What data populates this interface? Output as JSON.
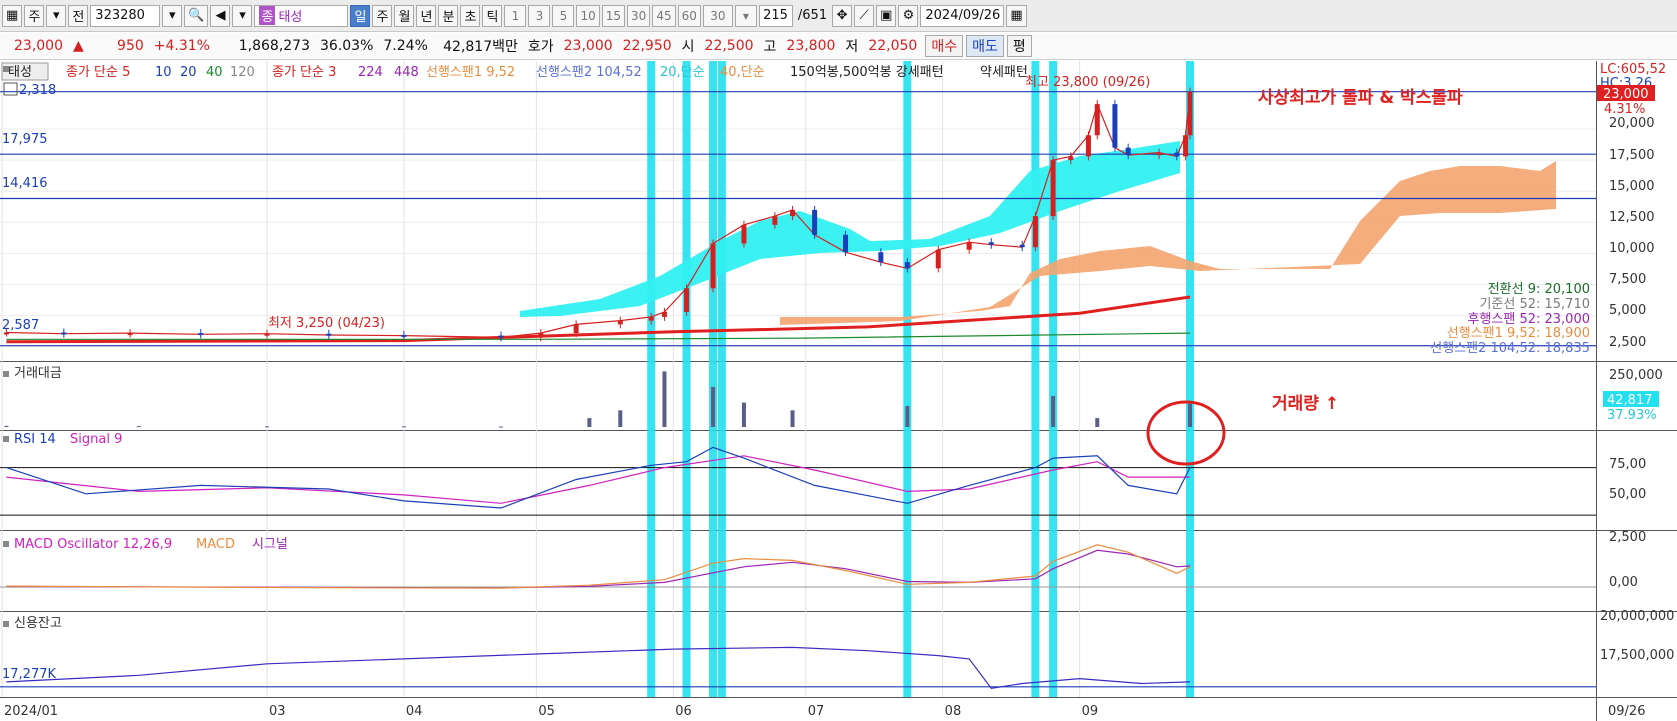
{
  "toolbar": {
    "period_buttons": [
      "주",
      "전"
    ],
    "code": "323280",
    "stock_prefix": "종",
    "stock_name": "태성",
    "timeframes": [
      "일",
      "주",
      "월",
      "년",
      "분",
      "초",
      "틱"
    ],
    "active_timeframe": "일",
    "intervals": [
      "1",
      "3",
      "5",
      "10",
      "15",
      "30",
      "45",
      "60"
    ],
    "interval_value": "30",
    "count": "215",
    "total": "/651",
    "date": "2024/09/26"
  },
  "quote": {
    "price": "23,000",
    "change": "950",
    "pct": "+4.31%",
    "volume": "1,868,273",
    "vol_ratio": "36.03%",
    "turnover": "7.24%",
    "amount": "42,817백만",
    "ask_label": "호가",
    "ask": "23,000",
    "bid": "22,950",
    "open_label": "시",
    "open": "22,500",
    "high_label": "고",
    "high": "23,800",
    "low_label": "저",
    "low": "22,050",
    "buy": "매수",
    "sell": "매도",
    "eval": "평"
  },
  "colors": {
    "up": "#d62020",
    "down": "#1b3fb8",
    "highlight": "#22e0f0",
    "cloud": "#f4a46f",
    "cyan_fill": "#30f0f0",
    "annotation": "#e02020"
  },
  "chart_data": {
    "type": "line",
    "title": "태성 일봉 차트",
    "price_panel": {
      "legend": [
        "태성",
        "종가 단순 5",
        "10",
        "20",
        "40",
        "120",
        "종가 단순 3",
        "224",
        "448",
        "선행스팬1 9,52",
        "선행스팬2 104,52",
        "20,단순",
        "40,단순",
        "150억봉,500억봉 강세패턴",
        "약세패턴"
      ],
      "y_ticks": [
        "20,000",
        "17,500",
        "15,000",
        "12,500",
        "10,000",
        "7,500",
        "5,000",
        "2,500"
      ],
      "ylim": [
        2000,
        24500
      ],
      "right_labels": {
        "lc": "LC:605,52",
        "price": "23,000",
        "pct": "4.31%",
        "hc": "HC:3.26"
      },
      "h_lines": [
        {
          "label": "2,318",
          "value": 23000
        },
        {
          "label": "17,975",
          "value": 17975
        },
        {
          "label": "14,416",
          "value": 14416
        },
        {
          "label": "2,587",
          "value": 2587
        }
      ],
      "max_note": "최고 23,800 (09/26)",
      "min_note": "최저 3,250 (04/23)",
      "annotation": "사상최고가 돌파 & 박스돌파",
      "ichimoku": [
        {
          "label": "전환선 9: 20,100",
          "color": "#1b6e2c"
        },
        {
          "label": "기준선 52: 15,710",
          "color": "#7a7a7a"
        },
        {
          "label": "후행스팬 52: 23,000",
          "color": "#9b26b6"
        },
        {
          "label": "선행스팬1 9,52: 18,900",
          "color": "#e98d3f"
        },
        {
          "label": "선행스팬2 104,52: 18,835",
          "color": "#5b6fd6"
        }
      ],
      "close_series": [
        [
          "01/02",
          3650
        ],
        [
          "01/15",
          3550
        ],
        [
          "01/30",
          3600
        ],
        [
          "02/15",
          3500
        ],
        [
          "03/01",
          3550
        ],
        [
          "03/15",
          3450
        ],
        [
          "04/01",
          3400
        ],
        [
          "04/23",
          3250
        ],
        [
          "05/02",
          3600
        ],
        [
          "05/10",
          4300
        ],
        [
          "05/20",
          4600
        ],
        [
          "05/27",
          4900
        ],
        [
          "05/30",
          5300
        ],
        [
          "06/04",
          7200
        ],
        [
          "06/10",
          10800
        ],
        [
          "06/17",
          12300
        ],
        [
          "06/24",
          13000
        ],
        [
          "06/28",
          13500
        ],
        [
          "07/03",
          11500
        ],
        [
          "07/10",
          10100
        ],
        [
          "07/18",
          9300
        ],
        [
          "07/24",
          8800
        ],
        [
          "07/31",
          10300
        ],
        [
          "08/07",
          10900
        ],
        [
          "08/12",
          10700
        ],
        [
          "08/19",
          10500
        ],
        [
          "08/22",
          13000
        ],
        [
          "08/26",
          17500
        ],
        [
          "08/30",
          17800
        ],
        [
          "09/03",
          19500
        ],
        [
          "09/05",
          22000
        ],
        [
          "09/09",
          18500
        ],
        [
          "09/12",
          17900
        ],
        [
          "09/19",
          18100
        ],
        [
          "09/23",
          17800
        ],
        [
          "09/25",
          19500
        ],
        [
          "09/26",
          23000
        ]
      ]
    },
    "volume_panel": {
      "title": "거래대금",
      "y_ticks": [
        "250,000"
      ],
      "ylim": [
        0,
        270000
      ],
      "current": "42,817",
      "pct": "37.93%",
      "annotation": "거래량 ↑",
      "values": [
        [
          "01/02",
          5000
        ],
        [
          "02/01",
          4000
        ],
        [
          "03/01",
          3000
        ],
        [
          "04/01",
          3000
        ],
        [
          "04/23",
          2000
        ],
        [
          "05/13",
          40000
        ],
        [
          "05/20",
          75000
        ],
        [
          "05/30",
          250000
        ],
        [
          "06/10",
          180000
        ],
        [
          "06/17",
          110000
        ],
        [
          "06/28",
          75000
        ],
        [
          "07/24",
          95000
        ],
        [
          "08/26",
          140000
        ],
        [
          "09/05",
          40000
        ],
        [
          "09/26",
          105000
        ]
      ]
    },
    "rsi_panel": {
      "title": "RSI 14",
      "signal_label": "Signal 9",
      "y_ticks": [
        "75,00",
        "50,00"
      ],
      "ylim": [
        20,
        100
      ],
      "rsi": [
        [
          "01/02",
          70
        ],
        [
          "01/20",
          48
        ],
        [
          "02/15",
          55
        ],
        [
          "03/15",
          52
        ],
        [
          "04/01",
          42
        ],
        [
          "04/23",
          36
        ],
        [
          "05/10",
          60
        ],
        [
          "05/27",
          72
        ],
        [
          "06/04",
          75
        ],
        [
          "06/10",
          87
        ],
        [
          "06/17",
          78
        ],
        [
          "07/03",
          55
        ],
        [
          "07/24",
          40
        ],
        [
          "08/07",
          55
        ],
        [
          "08/22",
          70
        ],
        [
          "08/26",
          78
        ],
        [
          "09/05",
          80
        ],
        [
          "09/12",
          55
        ],
        [
          "09/23",
          48
        ],
        [
          "09/26",
          70
        ]
      ],
      "signal": [
        [
          "01/02",
          62
        ],
        [
          "02/01",
          50
        ],
        [
          "03/01",
          53
        ],
        [
          "04/01",
          47
        ],
        [
          "04/23",
          40
        ],
        [
          "05/13",
          55
        ],
        [
          "05/30",
          70
        ],
        [
          "06/17",
          80
        ],
        [
          "07/03",
          68
        ],
        [
          "07/24",
          50
        ],
        [
          "08/07",
          52
        ],
        [
          "08/26",
          68
        ],
        [
          "09/05",
          75
        ],
        [
          "09/12",
          62
        ],
        [
          "09/26",
          62
        ]
      ]
    },
    "macd_panel": {
      "title": "MACD Oscillator 12,26,9",
      "macd_label": "MACD",
      "signal_label": "시그널",
      "y_ticks": [
        "2,500",
        "0,00"
      ],
      "ylim": [
        -1200,
        3000
      ],
      "macd": [
        [
          "01/02",
          50
        ],
        [
          "03/01",
          -30
        ],
        [
          "04/23",
          -60
        ],
        [
          "05/13",
          100
        ],
        [
          "05/30",
          400
        ],
        [
          "06/10",
          1300
        ],
        [
          "06/17",
          1550
        ],
        [
          "06/28",
          1450
        ],
        [
          "07/10",
          900
        ],
        [
          "07/24",
          150
        ],
        [
          "08/07",
          250
        ],
        [
          "08/22",
          600
        ],
        [
          "08/26",
          1400
        ],
        [
          "09/05",
          2300
        ],
        [
          "09/12",
          1900
        ],
        [
          "09/23",
          750
        ],
        [
          "09/26",
          1100
        ]
      ],
      "signal": [
        [
          "01/02",
          30
        ],
        [
          "03/01",
          -10
        ],
        [
          "04/23",
          -50
        ],
        [
          "05/13",
          40
        ],
        [
          "05/30",
          250
        ],
        [
          "06/17",
          1100
        ],
        [
          "06/28",
          1350
        ],
        [
          "07/10",
          1000
        ],
        [
          "07/24",
          300
        ],
        [
          "08/07",
          250
        ],
        [
          "08/22",
          450
        ],
        [
          "08/26",
          1000
        ],
        [
          "09/05",
          2000
        ],
        [
          "09/12",
          1800
        ],
        [
          "09/23",
          1100
        ],
        [
          "09/26",
          1150
        ]
      ]
    },
    "credit_panel": {
      "title": "신용잔고",
      "left_label": "17,277K",
      "y_ticks": [
        "20,000,000",
        "17,500,000"
      ],
      "ylim": [
        16500000,
        21500000
      ],
      "values": [
        [
          "01/02",
          17300000
        ],
        [
          "02/01",
          17700000
        ],
        [
          "03/01",
          18400000
        ],
        [
          "04/01",
          18700000
        ],
        [
          "05/01",
          19000000
        ],
        [
          "06/01",
          19300000
        ],
        [
          "06/28",
          19400000
        ],
        [
          "07/15",
          19200000
        ],
        [
          "07/31",
          18900000
        ],
        [
          "08/07",
          18700000
        ],
        [
          "08/12",
          16900000
        ],
        [
          "08/19",
          17200000
        ],
        [
          "09/01",
          17500000
        ],
        [
          "09/15",
          17200000
        ],
        [
          "09/26",
          17300000
        ]
      ]
    },
    "x_ticks": [
      "2024/01",
      "03",
      "04",
      "05",
      "06",
      "07",
      "08",
      "09"
    ],
    "x_tick_dates": [
      "01/01",
      "03/01",
      "04/01",
      "05/01",
      "06/01",
      "07/01",
      "08/01",
      "09/01"
    ],
    "current_date": "09/26",
    "highlight_dates": [
      "05/27",
      "06/04",
      "06/10",
      "06/12",
      "07/24",
      "08/22",
      "08/26",
      "09/26"
    ]
  }
}
